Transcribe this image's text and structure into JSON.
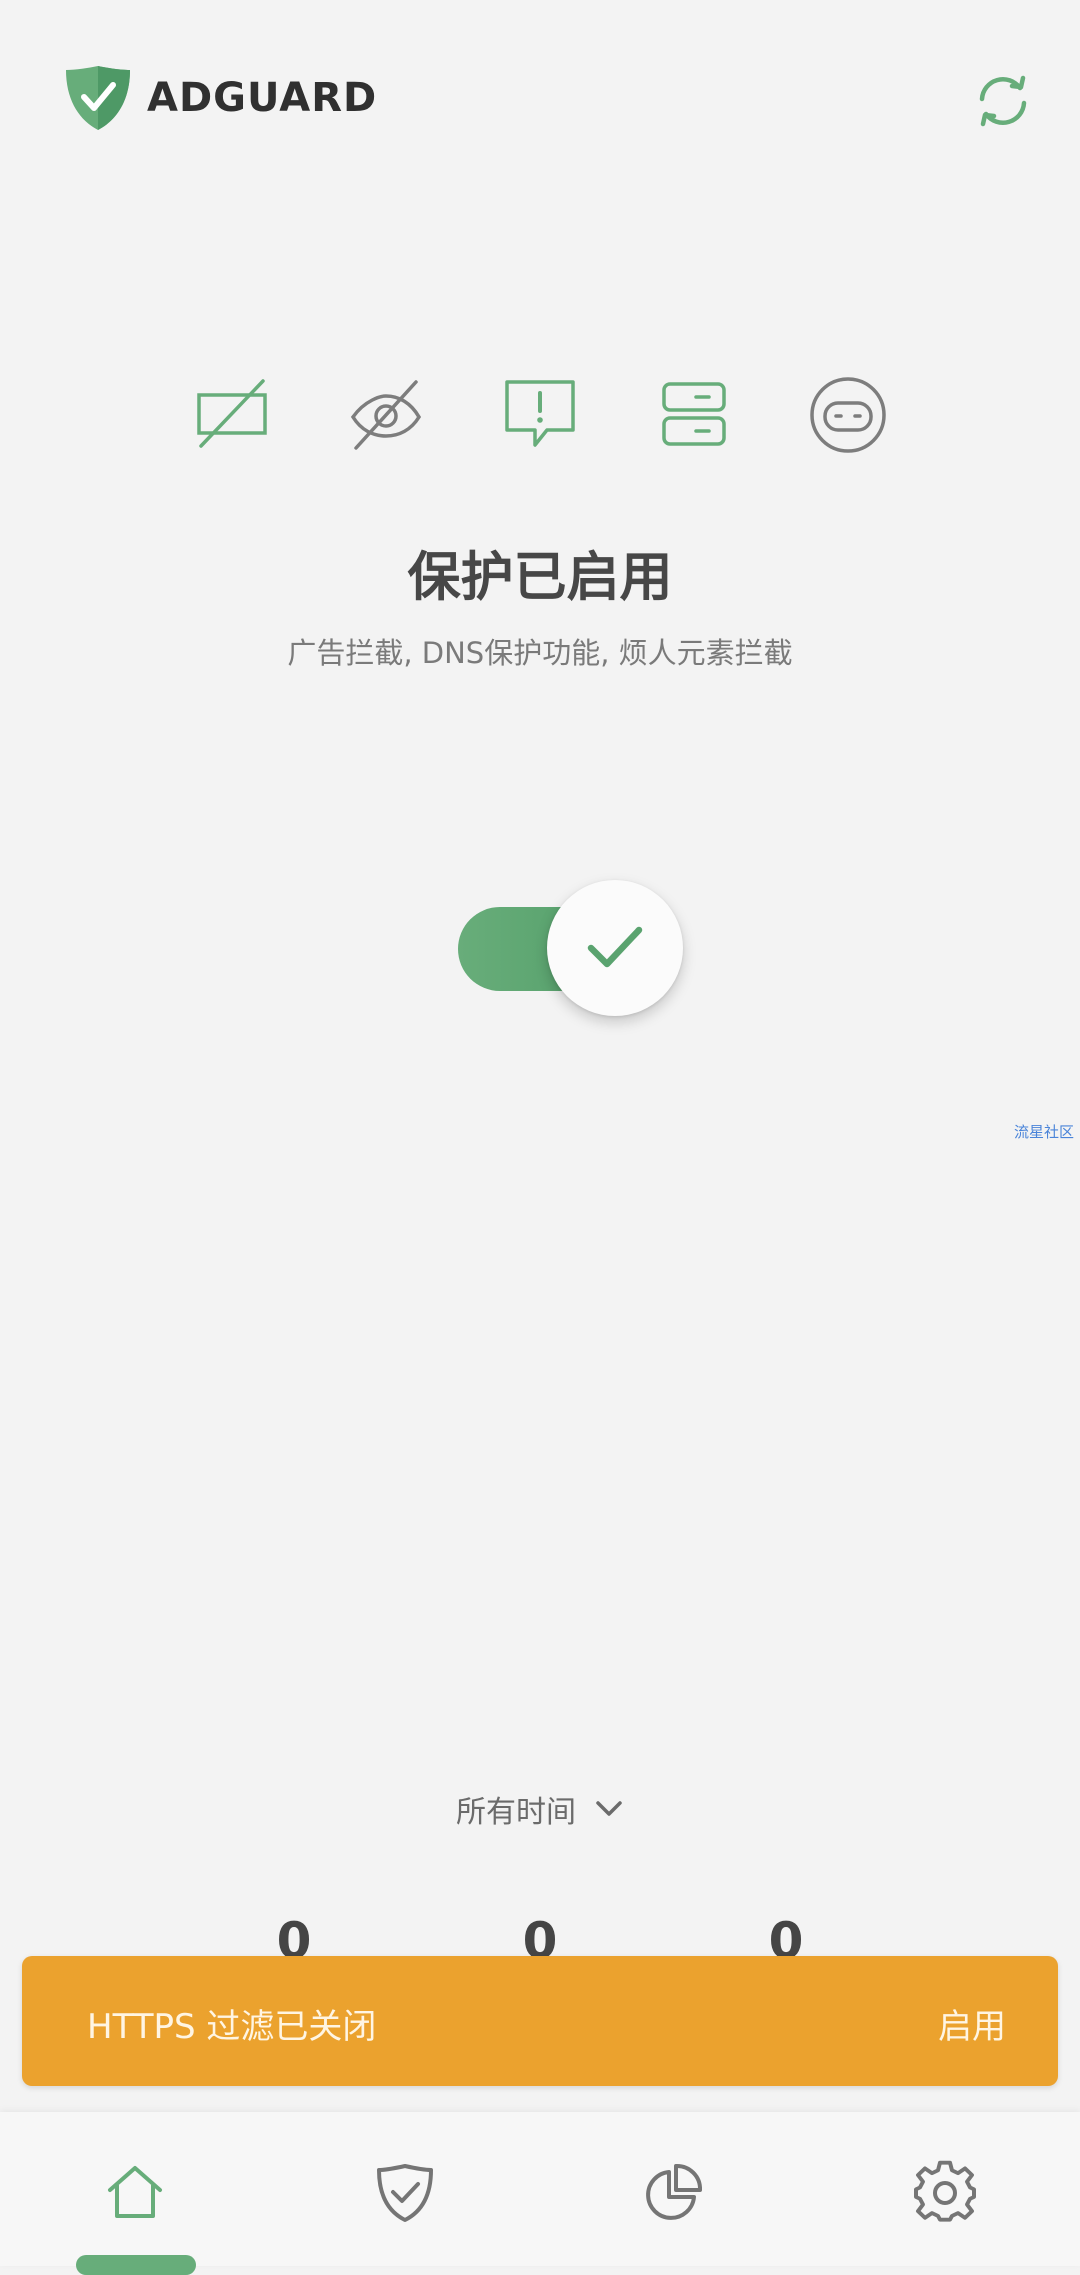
{
  "app": {
    "logo_text": "ADGUARD"
  },
  "status": {
    "title": "保护已启用",
    "subtitle": "广告拦截, DNS保护功能, 烦人元素拦截"
  },
  "watermark": "流星社区",
  "stats": {
    "range_label": "所有时间",
    "values": [
      "0",
      "0",
      "0"
    ]
  },
  "banner": {
    "text": "HTTPS 过滤已关闭",
    "action": "启用"
  },
  "colors": {
    "accent": "#67ad7a",
    "banner": "#eba22e",
    "icon_gray": "#7d7d7d"
  },
  "icons": {
    "top_right": "refresh-icon",
    "features": [
      "ad-blocking-icon",
      "tracking-protection-icon",
      "annoyance-blocking-icon",
      "dns-protection-icon",
      "browsing-security-icon"
    ],
    "nav": [
      "home-icon",
      "protection-shield-icon",
      "statistics-icon",
      "settings-icon"
    ]
  }
}
